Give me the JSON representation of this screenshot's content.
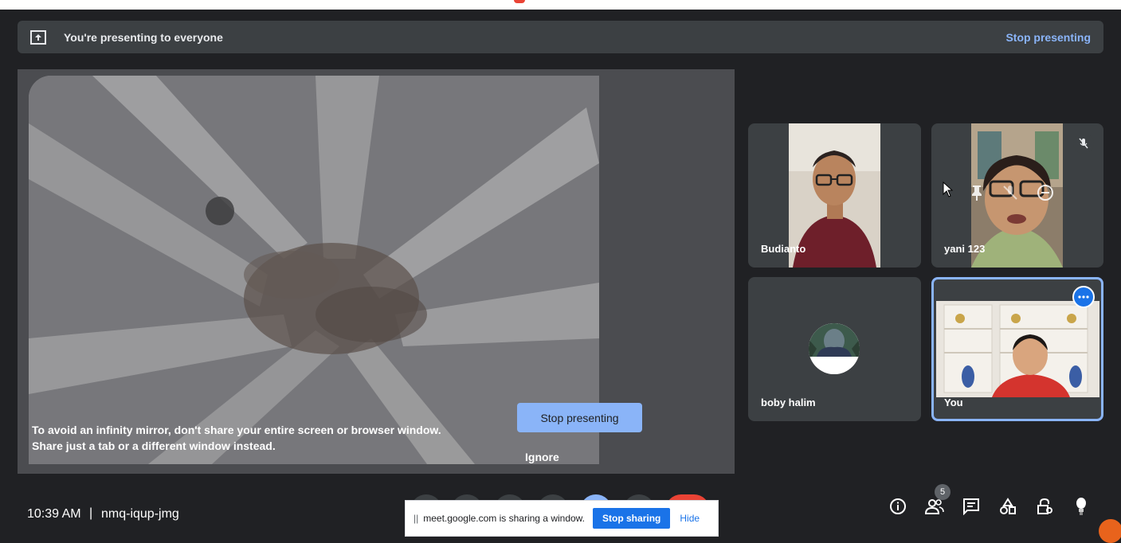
{
  "banner": {
    "text": "You're presenting to everyone",
    "stop_label": "Stop presenting"
  },
  "presentation": {
    "warning_line1": "To avoid an infinity mirror, don't share your entire screen or browser window.",
    "warning_line2": "Share just a tab or a different window instead.",
    "stop_button": "Stop presenting",
    "ignore_button": "Ignore"
  },
  "participants": [
    {
      "name": "Budianto"
    },
    {
      "name": "yani 123"
    },
    {
      "name": "boby halim"
    },
    {
      "name": "You"
    }
  ],
  "meeting": {
    "time": "10:39 AM",
    "separator": "|",
    "code": "nmq-iqup-jmg"
  },
  "share_bar": {
    "grip": "||",
    "message": "meet.google.com is sharing a window.",
    "stop_sharing": "Stop sharing",
    "hide": "Hide"
  },
  "people_count": "5",
  "colors": {
    "background": "#202124",
    "accent": "#8ab4f8",
    "end_call": "#ea4335",
    "primary_blue": "#1a73e8"
  }
}
